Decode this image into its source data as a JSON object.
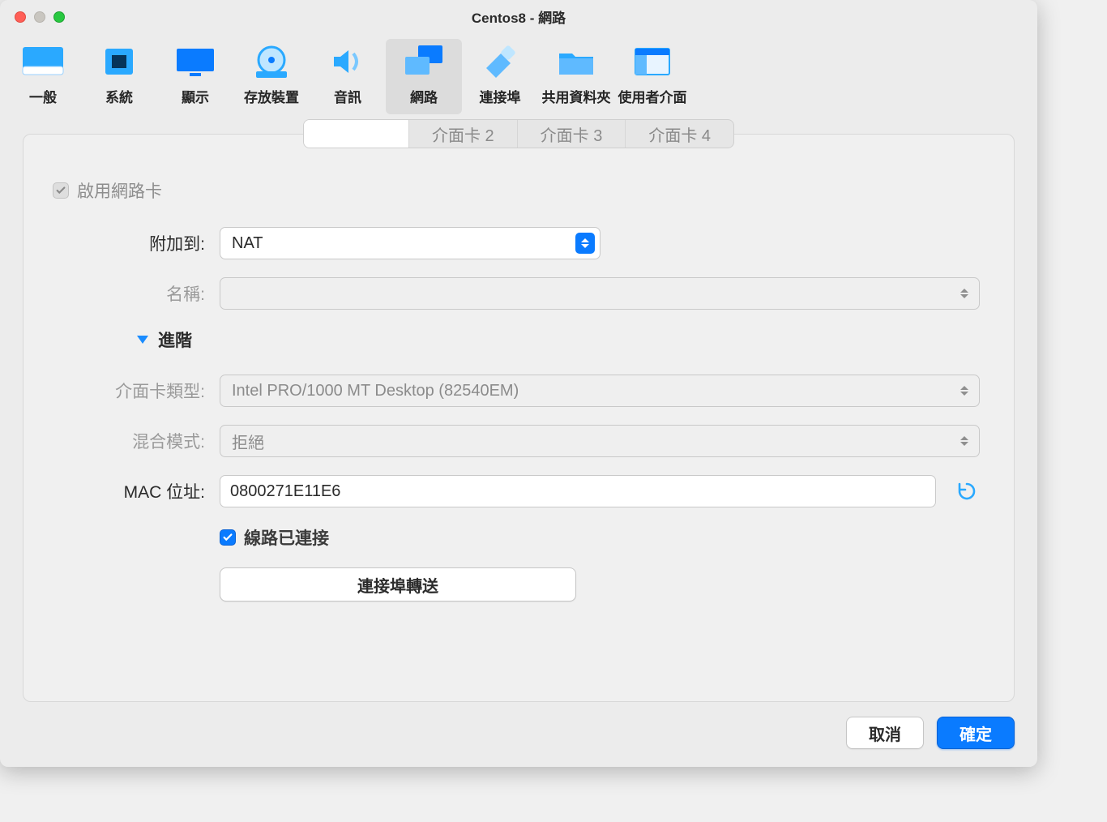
{
  "window": {
    "title": "Centos8 - 網路"
  },
  "toolbar": {
    "items": [
      {
        "key": "general",
        "label": "一般"
      },
      {
        "key": "system",
        "label": "系統"
      },
      {
        "key": "display",
        "label": "顯示"
      },
      {
        "key": "storage",
        "label": "存放裝置"
      },
      {
        "key": "audio",
        "label": "音訊"
      },
      {
        "key": "network",
        "label": "網路",
        "active": true
      },
      {
        "key": "ports",
        "label": "連接埠"
      },
      {
        "key": "shared",
        "label": "共用資料夾"
      },
      {
        "key": "ui",
        "label": "使用者介面"
      }
    ]
  },
  "tabs": {
    "items": [
      {
        "key": "adapter1",
        "label": "",
        "active": true
      },
      {
        "key": "adapter2",
        "label": "介面卡 2"
      },
      {
        "key": "adapter3",
        "label": "介面卡 3"
      },
      {
        "key": "adapter4",
        "label": "介面卡 4"
      }
    ]
  },
  "form": {
    "enable_adapter_label": "啟用網路卡",
    "enable_adapter_checked": true,
    "attached_to_label": "附加到:",
    "attached_to_value": "NAT",
    "name_label": "名稱:",
    "name_value": "",
    "advanced_label": "進階",
    "adapter_type_label": "介面卡類型:",
    "adapter_type_value": "Intel PRO/1000 MT Desktop (82540EM)",
    "promiscuous_label": "混合模式:",
    "promiscuous_value": "拒絕",
    "mac_label": "MAC 位址:",
    "mac_value": "0800271E11E6",
    "cable_connected_label": "線路已連接",
    "cable_connected_checked": true,
    "port_forwarding_button": "連接埠轉送"
  },
  "footer": {
    "cancel": "取消",
    "ok": "確定"
  }
}
